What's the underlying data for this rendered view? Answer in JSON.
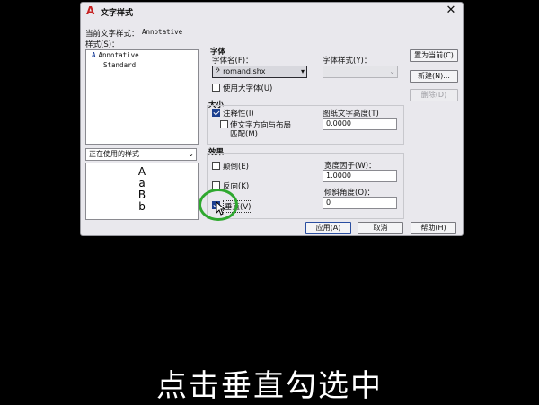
{
  "dialog": {
    "title": "文字样式",
    "close_symbol": "✕",
    "current_style_label": "当前文字样式：",
    "current_style_value": "Annotative",
    "styles_label": "样式(S)：",
    "styles": [
      {
        "icon": "A",
        "name": "Annotative"
      },
      {
        "icon": "",
        "name": "Standard"
      }
    ],
    "filter_select": "正在使用的样式",
    "preview_chars": [
      "A",
      "a",
      "B",
      "b"
    ]
  },
  "font": {
    "group_label": "字体",
    "font_name_label": "字体名(F)：",
    "font_name_value": "romand.shx",
    "font_style_label": "字体样式(Y)：",
    "font_style_value": "",
    "use_bigfont_label": "使用大字体(U)"
  },
  "size": {
    "group_label": "大小",
    "annotative_label": "注释性(I)",
    "match_orientation_label_1": "使文字方向与布局",
    "match_orientation_label_2": "匹配(M)",
    "paper_height_label": "图纸文字高度(T)",
    "paper_height_value": "0.0000"
  },
  "effects": {
    "group_label": "效果",
    "upside_down_label": "颠倒(E)",
    "backwards_label": "反向(K)",
    "vertical_label": "垂直(V)",
    "width_factor_label": "宽度因子(W)：",
    "width_factor_value": "1.0000",
    "oblique_label": "倾斜角度(O)：",
    "oblique_value": "0"
  },
  "side_buttons": {
    "set_current": "置为当前(C)",
    "new": "新建(N)...",
    "delete": "删除(D)"
  },
  "bottom_buttons": {
    "apply": "应用(A)",
    "cancel": "取消",
    "help": "帮助(H)"
  },
  "caption": "点击垂直勾选中",
  "colors": {
    "accent": "#1c3f8f",
    "highlight": "#2fa82f",
    "app_icon": "#c62020"
  }
}
